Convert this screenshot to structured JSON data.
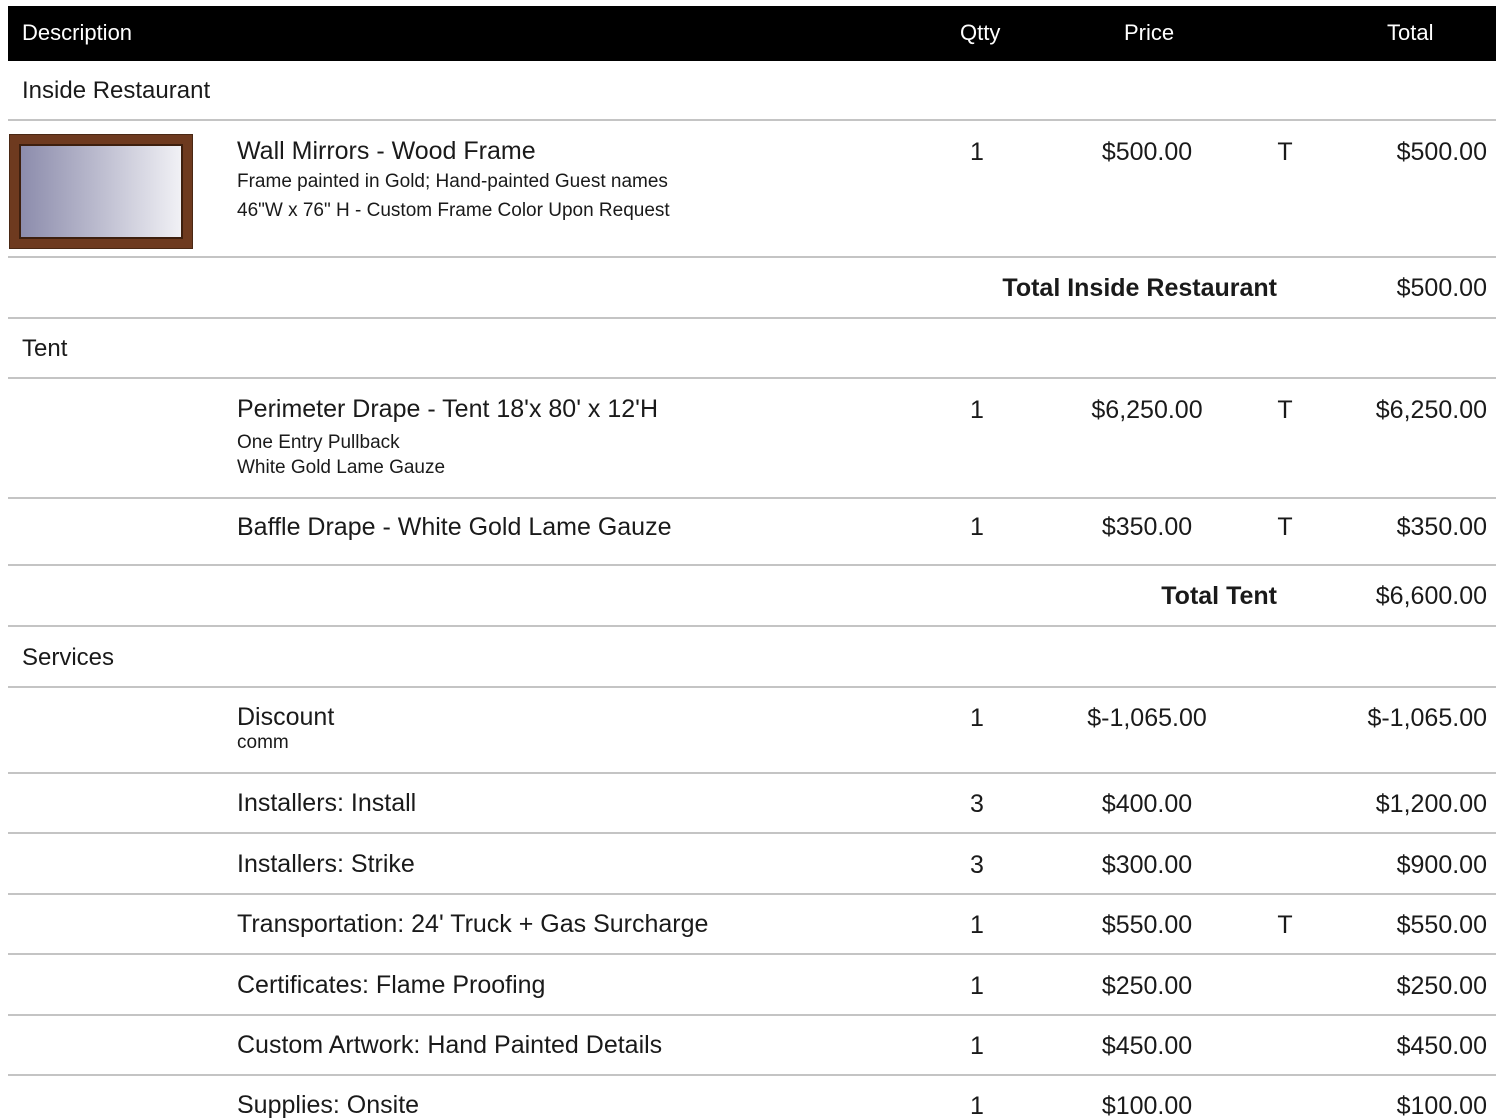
{
  "header": {
    "description": "Description",
    "qty": "Qtty",
    "price": "Price",
    "total": "Total"
  },
  "sections": [
    {
      "title": "Inside Restaurant",
      "items": [
        {
          "name": "Wall Mirrors - Wood Frame",
          "details": [
            "Frame painted in Gold; Hand-painted Guest names",
            "46\"W  x 76\" H - Custom Frame Color Upon Request"
          ],
          "qty": "1",
          "price": "$500.00",
          "tax": "T",
          "total": "$500.00",
          "image": "wall-mirror-wood-frame"
        }
      ],
      "subtotal_label": "Total Inside Restaurant",
      "subtotal": "$500.00"
    },
    {
      "title": "Tent",
      "items": [
        {
          "name": "Perimeter Drape  - Tent 18'x 80' x 12'H",
          "details": [
            "One Entry Pullback",
            "White Gold Lame Gauze"
          ],
          "qty": "1",
          "price": "$6,250.00",
          "tax": "T",
          "total": "$6,250.00"
        },
        {
          "name": "Baffle Drape - White Gold Lame Gauze",
          "qty": "1",
          "price": "$350.00",
          "tax": "T",
          "total": "$350.00"
        }
      ],
      "subtotal_label": "Total Tent",
      "subtotal": "$6,600.00"
    },
    {
      "title": "Services",
      "items": [
        {
          "name": "Discount",
          "details": [
            "comm"
          ],
          "qty": "1",
          "price": "$-1,065.00",
          "tax": "",
          "total": "$-1,065.00"
        },
        {
          "name": "Installers: Install",
          "qty": "3",
          "price": "$400.00",
          "tax": "",
          "total": "$1,200.00"
        },
        {
          "name": "Installers: Strike",
          "qty": "3",
          "price": "$300.00",
          "tax": "",
          "total": "$900.00"
        },
        {
          "name": "Transportation: 24' Truck + Gas Surcharge",
          "qty": "1",
          "price": "$550.00",
          "tax": "T",
          "total": "$550.00"
        },
        {
          "name": "Certificates: Flame Proofing",
          "qty": "1",
          "price": "$250.00",
          "tax": "",
          "total": "$250.00"
        },
        {
          "name": "Custom Artwork: Hand Painted Details",
          "qty": "1",
          "price": "$450.00",
          "tax": "",
          "total": "$450.00"
        },
        {
          "name": "Supplies: Onsite",
          "qty": "1",
          "price": "$100.00",
          "tax": "",
          "total": "$100.00"
        }
      ]
    }
  ]
}
